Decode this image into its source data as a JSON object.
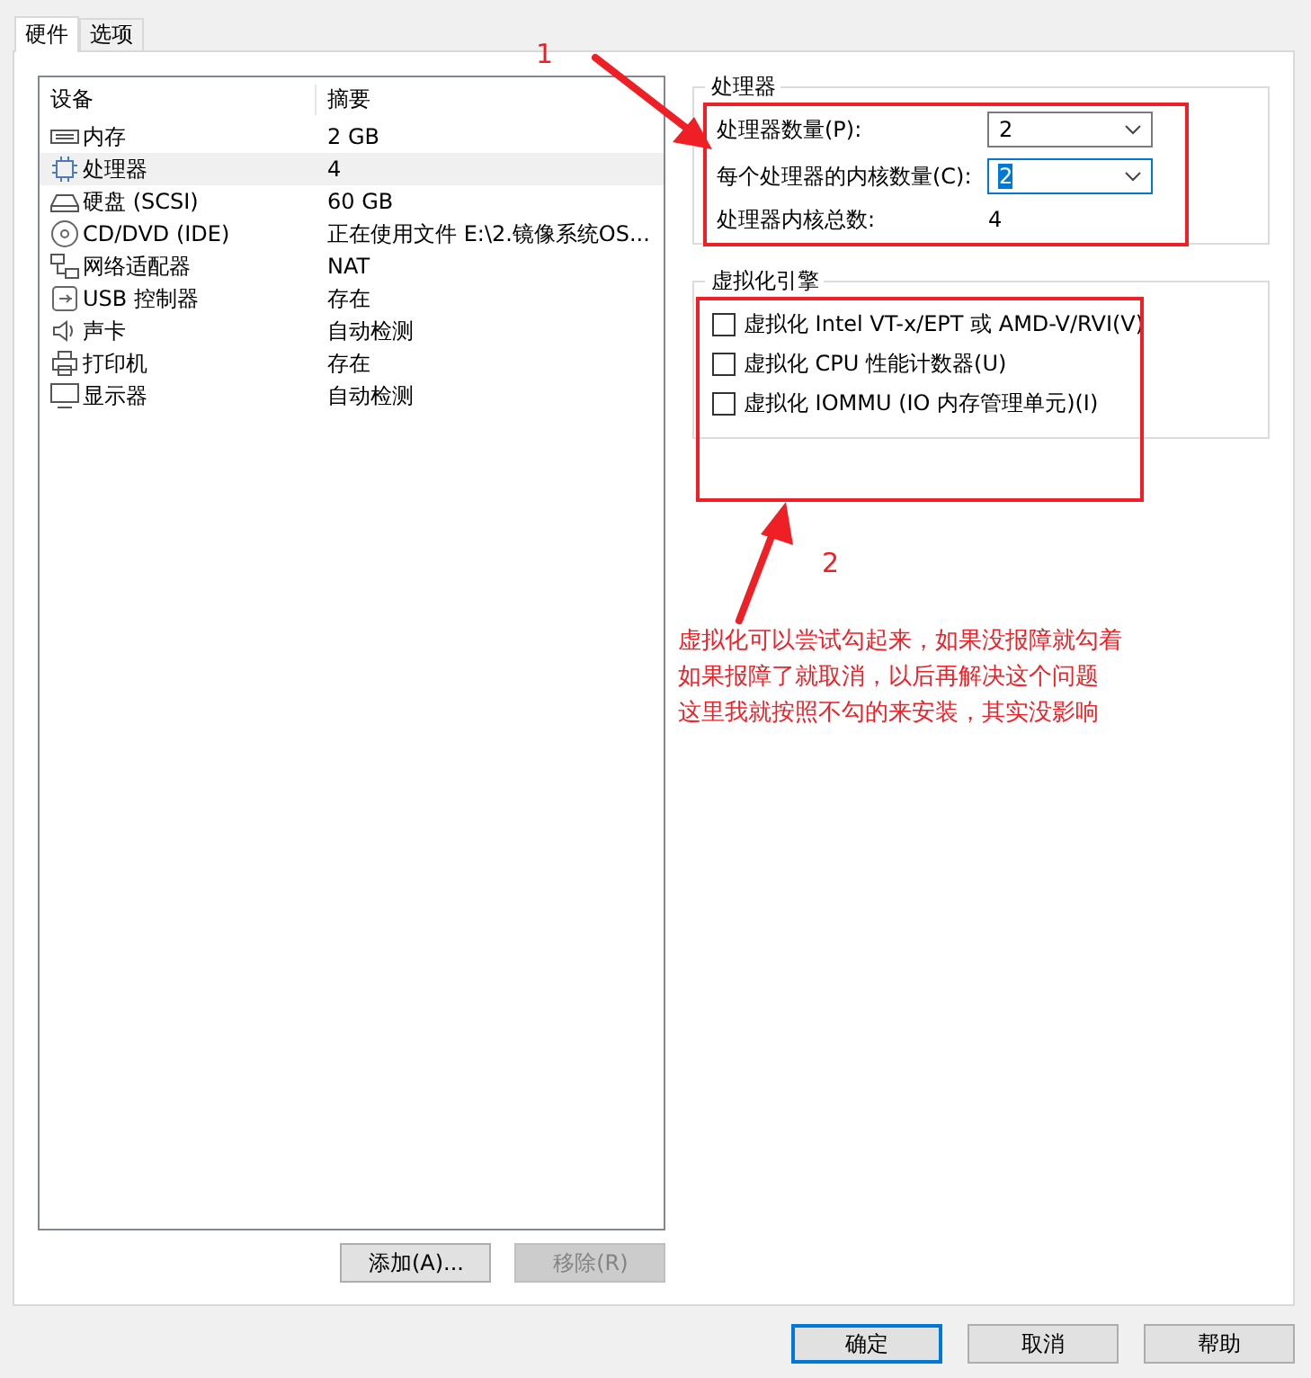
{
  "tabs": [
    {
      "label": "硬件",
      "selected": true
    },
    {
      "label": "选项",
      "selected": false
    }
  ],
  "device_list": {
    "columns": [
      "设备",
      "摘要"
    ],
    "rows": [
      {
        "kind": "memory",
        "device": "内存",
        "summary": "2 GB",
        "selected": false
      },
      {
        "kind": "cpu",
        "device": "处理器",
        "summary": "4",
        "selected": true
      },
      {
        "kind": "disk",
        "device": "硬盘 (SCSI)",
        "summary": "60 GB",
        "selected": false
      },
      {
        "kind": "cd",
        "device": "CD/DVD (IDE)",
        "summary": "正在使用文件 E:\\2.镜像系统OS...",
        "selected": false
      },
      {
        "kind": "network",
        "device": "网络适配器",
        "summary": "NAT",
        "selected": false
      },
      {
        "kind": "usb",
        "device": "USB 控制器",
        "summary": "存在",
        "selected": false
      },
      {
        "kind": "sound",
        "device": "声卡",
        "summary": "自动检测",
        "selected": false
      },
      {
        "kind": "printer",
        "device": "打印机",
        "summary": "存在",
        "selected": false
      },
      {
        "kind": "display",
        "device": "显示器",
        "summary": "自动检测",
        "selected": false
      }
    ]
  },
  "list_buttons": [
    {
      "label": "添加(A)...",
      "disabled": false
    },
    {
      "label": "移除(R)",
      "disabled": true
    }
  ],
  "processor_group": {
    "title": "处理器",
    "fields": [
      {
        "label": "处理器数量(P):",
        "value": "2",
        "focused": false
      },
      {
        "label": "每个处理器的内核数量(C):",
        "value": "2",
        "focused": true
      }
    ],
    "total_label": "处理器内核总数:",
    "total_value": "4"
  },
  "virtualization_group": {
    "title": "虚拟化引擎",
    "options": [
      {
        "label": "虚拟化 Intel VT-x/EPT 或 AMD-V/RVI(V)",
        "checked": false
      },
      {
        "label": "虚拟化 CPU 性能计数器(U)",
        "checked": false
      },
      {
        "label": "虚拟化 IOMMU (IO 内存管理单元)(I)",
        "checked": false
      }
    ]
  },
  "annotations": {
    "marker_1": "1",
    "marker_2": "2",
    "note": [
      "虚拟化可以尝试勾起来，如果没报障就勾着",
      "如果报障了就取消，以后再解决这个问题",
      "这里我就按照不勾的来安装，其实没影响"
    ]
  },
  "dialog_buttons": [
    {
      "label": "确定",
      "default": true
    },
    {
      "label": "取消",
      "default": false
    },
    {
      "label": "帮助",
      "default": false
    }
  ]
}
